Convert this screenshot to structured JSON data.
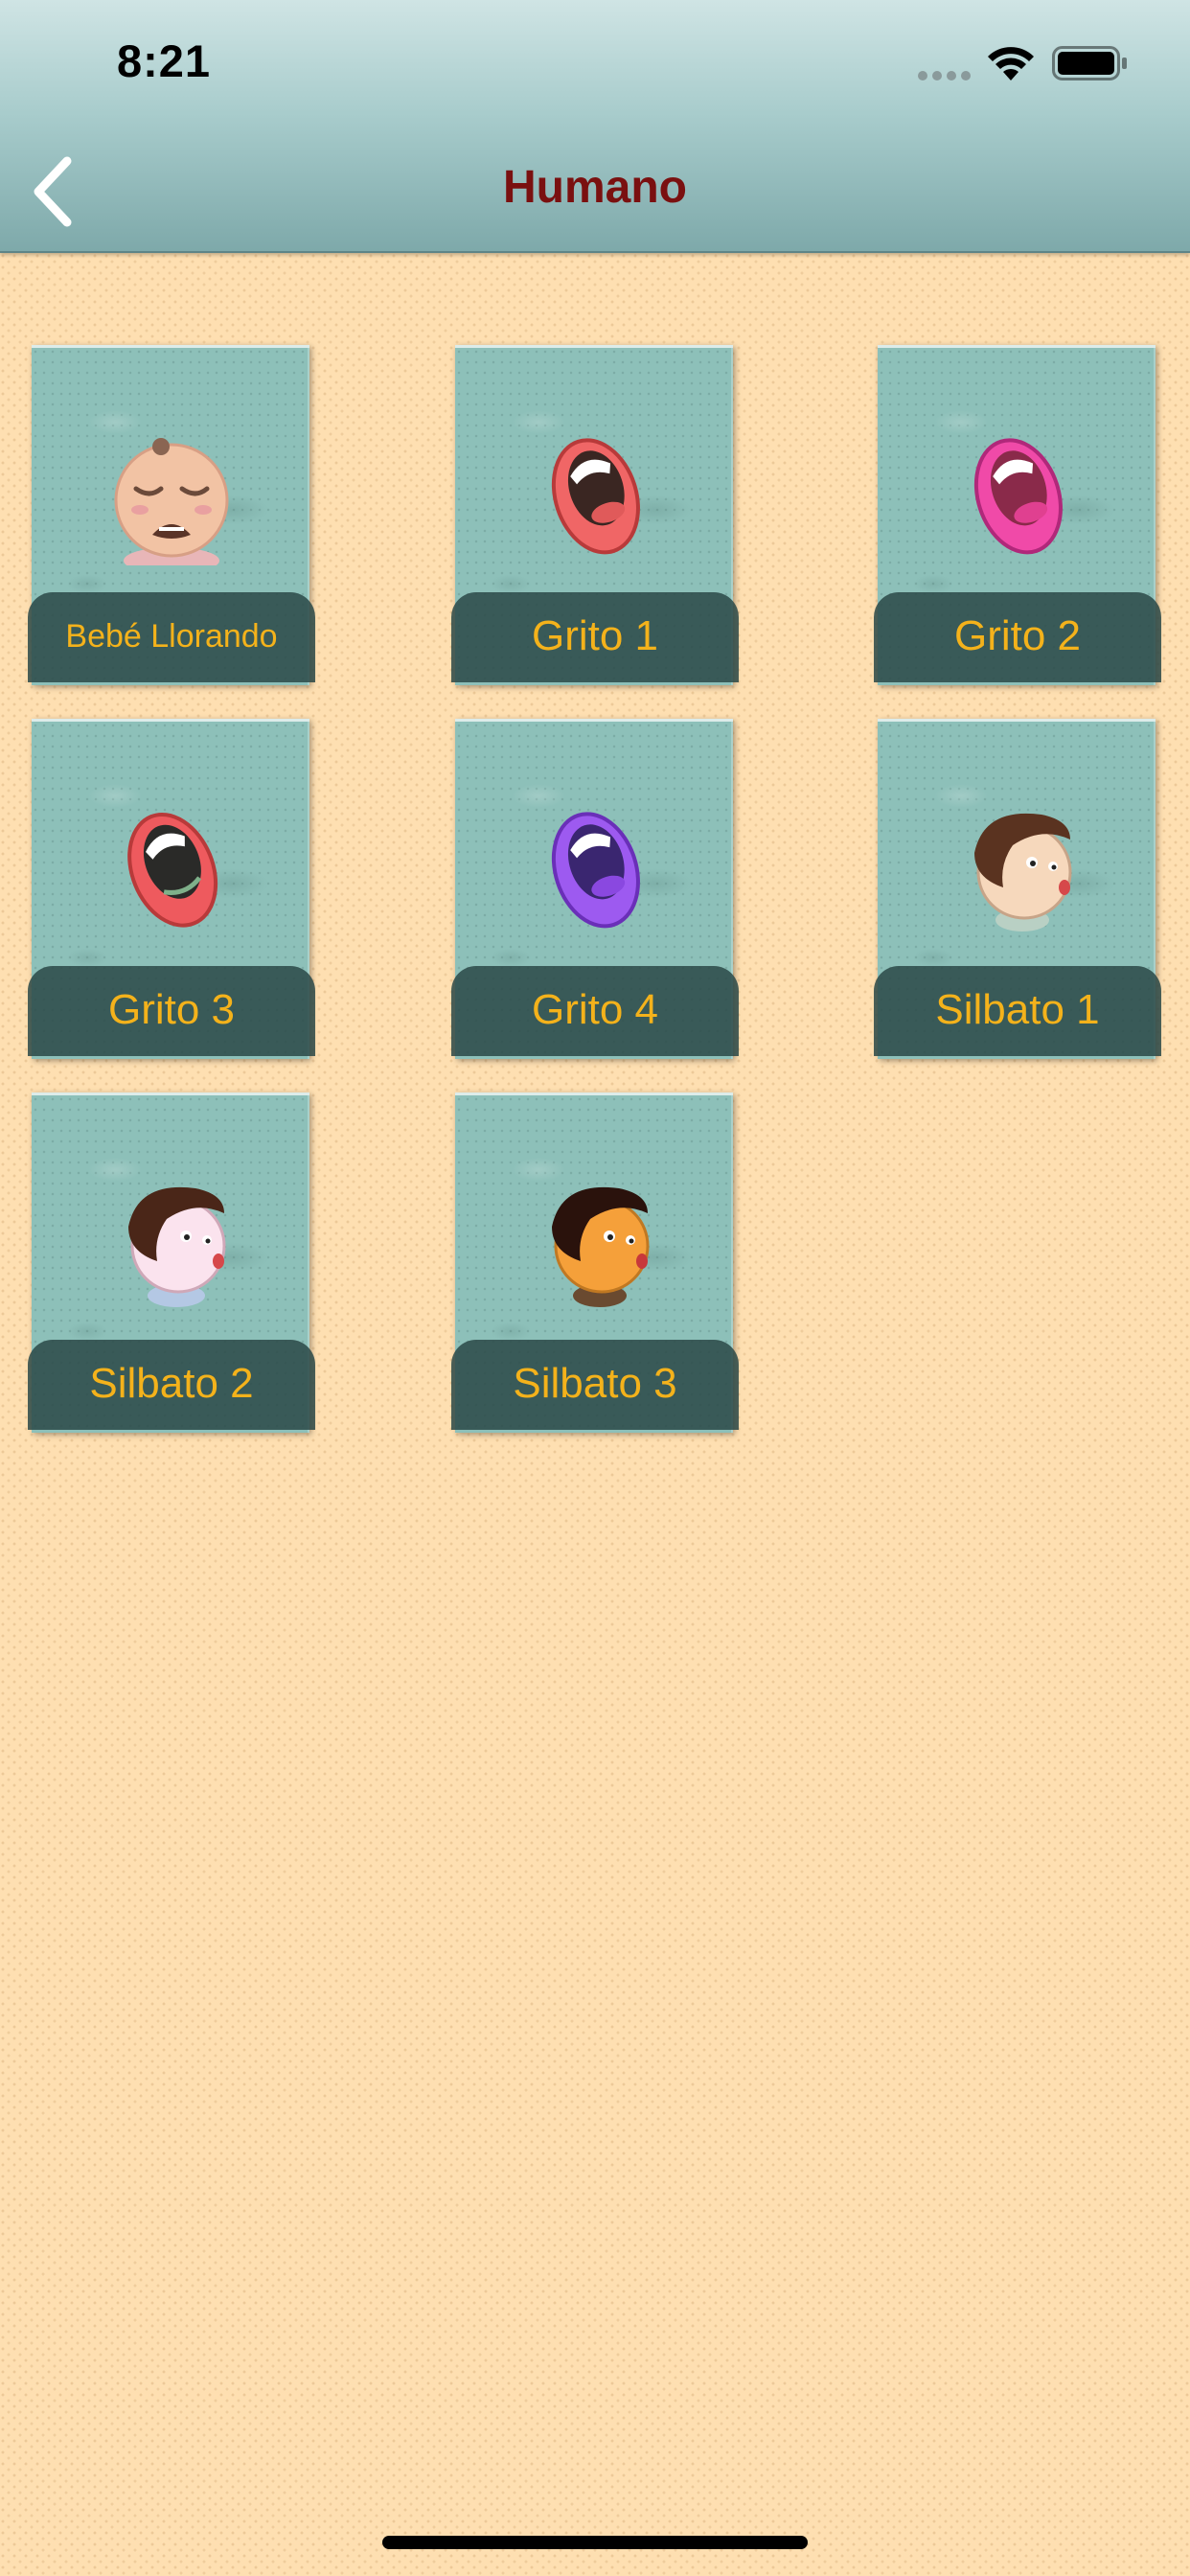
{
  "status_bar": {
    "time": "8:21"
  },
  "nav": {
    "title": "Humano",
    "back_icon": "chevron-left-icon"
  },
  "colors": {
    "title": "#7a1010",
    "label_text": "#f4b21b",
    "header": "#9fc4c4",
    "background": "#fedfb1"
  },
  "sounds": [
    {
      "label": "Bebé Llorando",
      "icon": "crying-baby-icon"
    },
    {
      "label": "Grito 1",
      "icon": "red-mouth-icon"
    },
    {
      "label": "Grito 2",
      "icon": "pink-mouth-icon"
    },
    {
      "label": "Grito 3",
      "icon": "red-mouth-icon"
    },
    {
      "label": "Grito 4",
      "icon": "purple-mouth-icon"
    },
    {
      "label": "Silbato 1",
      "icon": "whistling-boy-icon"
    },
    {
      "label": "Silbato 2",
      "icon": "whistling-boy-icon"
    },
    {
      "label": "Silbato 3",
      "icon": "whistling-boy-icon"
    }
  ]
}
